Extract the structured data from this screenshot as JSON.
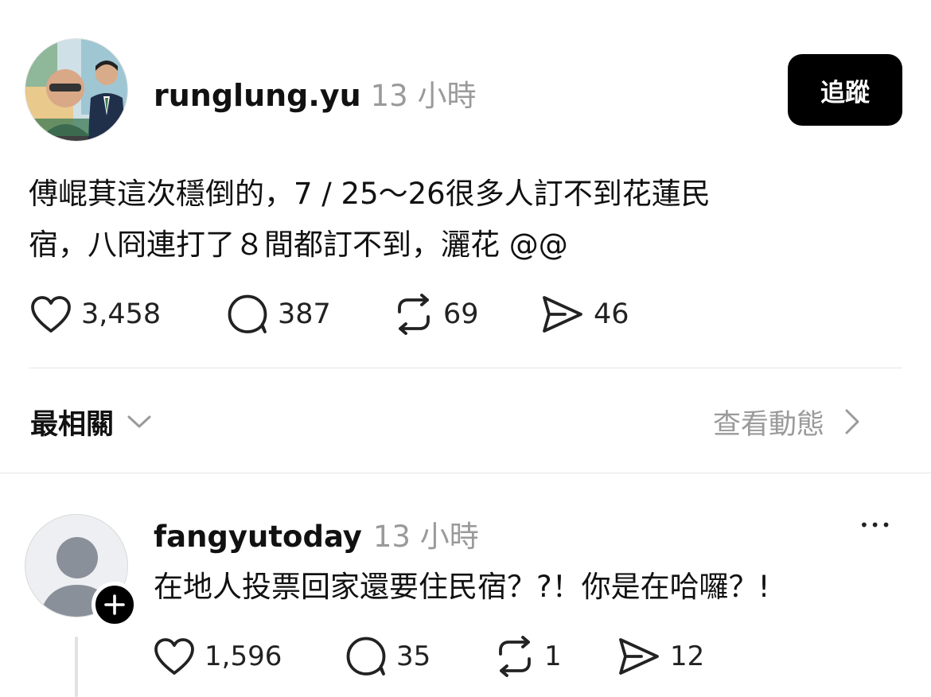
{
  "post": {
    "username": "runglung.yu",
    "time": "13 小時",
    "follow_label": "追蹤",
    "text_line1": "傅崐萁這次穩倒的，7 / 25～26很多人訂不到花蓮民",
    "text_line2": "宿，八冏連打了８間都訂不到，灑花 @@",
    "likes": "3,458",
    "comments": "387",
    "reposts": "69",
    "shares": "46"
  },
  "replies_header": {
    "sort_label": "最相關",
    "activity_label": "查看動態"
  },
  "reply": {
    "username": "fangyutoday",
    "time": "13 小時",
    "more_label": "•••",
    "text": "在地人投票回家還要住民宿？?！你是在哈囉？!",
    "likes": "1,596",
    "comments": "35",
    "reposts": "1",
    "shares": "12"
  },
  "icons": {
    "like": "heart-icon",
    "comment": "comment-bubble-icon",
    "repost": "repost-icon",
    "share": "send-icon",
    "sort": "chevron-down-icon",
    "activity": "chevron-right-icon",
    "follow": "plus-icon",
    "more": "more-icon"
  },
  "colors": {
    "button": "#000000",
    "muted_text": "#9a9a9a",
    "divider": "#e5e5e5"
  }
}
